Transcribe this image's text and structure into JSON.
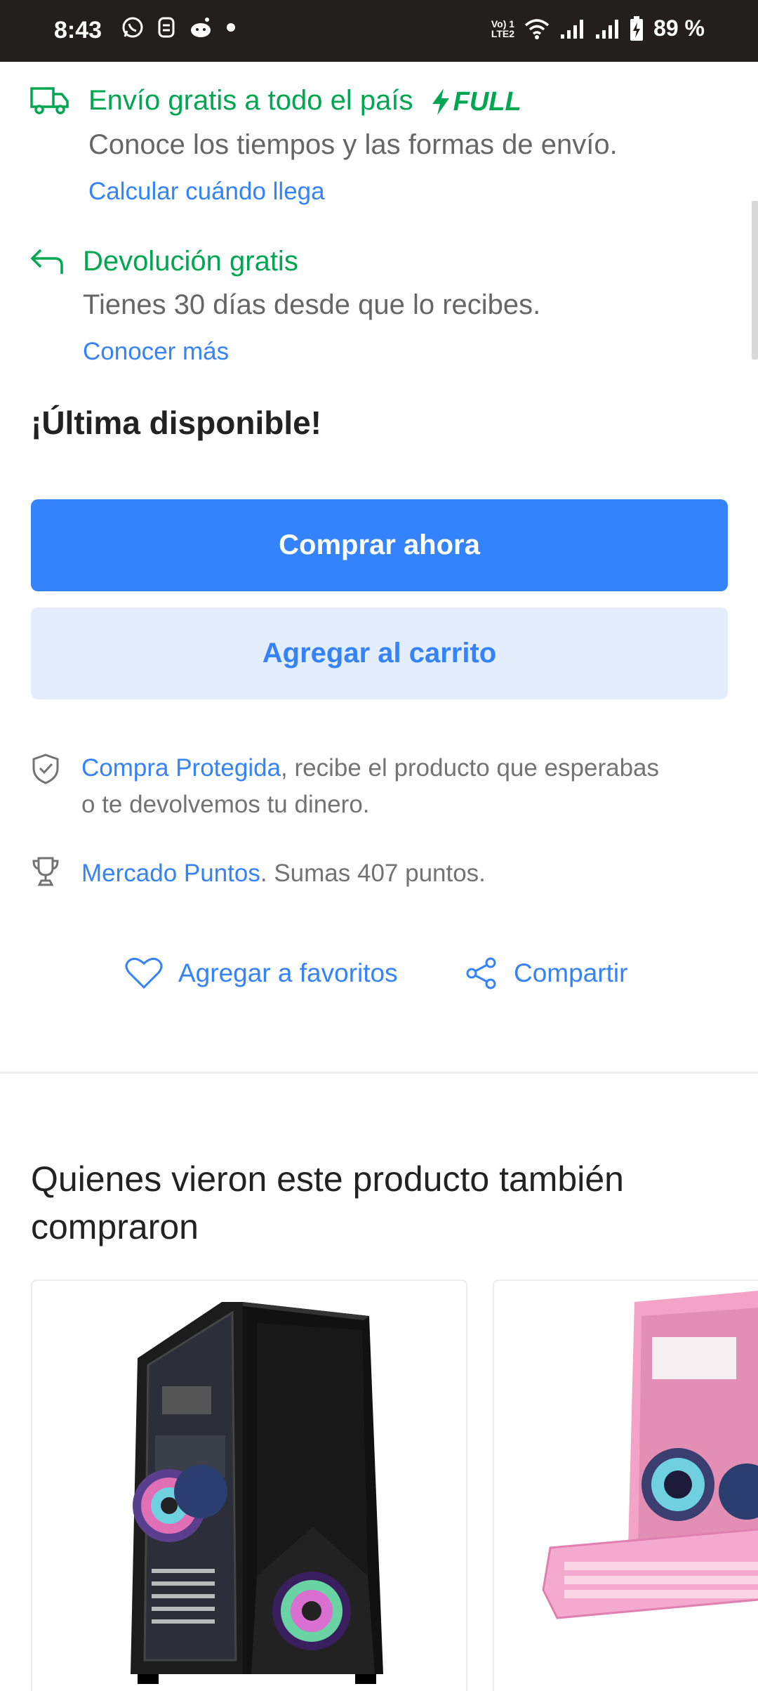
{
  "status_bar": {
    "time": "8:43",
    "volte_top": "Vo) 1",
    "volte_bottom": "LTE2",
    "battery_percent": "89 %"
  },
  "shipping": {
    "title": "Envío gratis a todo el país",
    "full_label": "FULL",
    "subtitle": "Conoce los tiempos y las formas de envío.",
    "link": "Calcular cuándo llega"
  },
  "returns": {
    "title": "Devolución gratis",
    "subtitle": "Tienes 30 días desde que lo recibes.",
    "link": "Conocer más"
  },
  "stock": {
    "label": "¡Última disponible!"
  },
  "buttons": {
    "buy_now": "Comprar ahora",
    "add_to_cart": "Agregar al carrito"
  },
  "protection": {
    "link": "Compra Protegida",
    "text_line1": ", recibe el producto que esperabas",
    "text_line2": "o te devolvemos tu dinero."
  },
  "points": {
    "link": "Mercado Puntos",
    "text": ". Sumas 407 puntos."
  },
  "actions": {
    "favorite": "Agregar a favoritos",
    "share": "Compartir"
  },
  "recommendations": {
    "title": "Quienes vieron este producto también compraron"
  },
  "colors": {
    "accent_blue": "#3483fa",
    "green": "#00a650",
    "secondary_button_bg": "#e3edfb"
  }
}
